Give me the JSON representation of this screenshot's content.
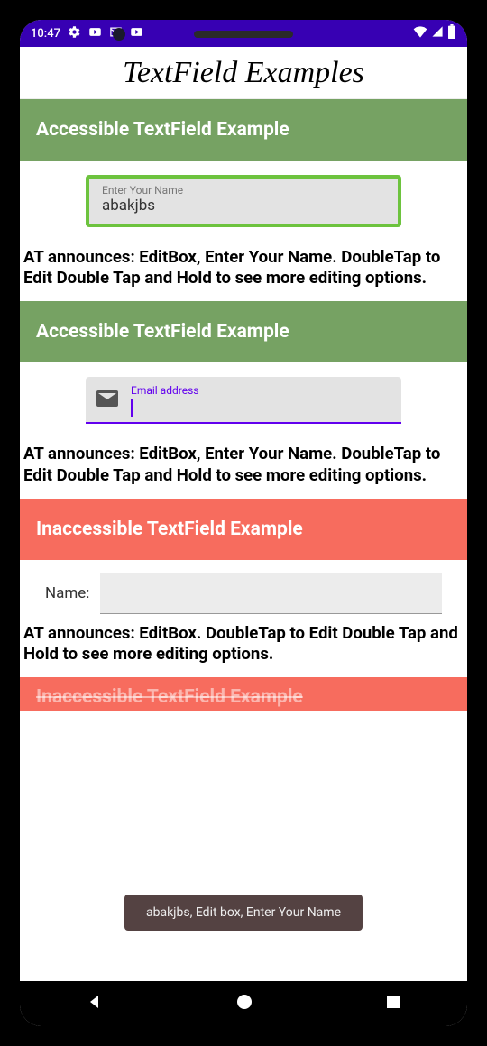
{
  "statusbar": {
    "time": "10:47"
  },
  "app": {
    "title": "TextField Examples"
  },
  "sections": [
    {
      "header": "Accessible TextField Example",
      "field_label": "Enter Your Name",
      "field_value": "abakjbs",
      "caption": "AT announces: EditBox, Enter Your Name. DoubleTap to Edit Double Tap and Hold to see more editing options."
    },
    {
      "header": "Accessible TextField Example",
      "field_label": "Email address",
      "caption": "AT announces: EditBox, Enter Your Name. DoubleTap to Edit Double Tap and Hold to see more editing options."
    },
    {
      "header": "Inaccessible TextField Example",
      "field_label": "Name:",
      "caption": "AT announces: EditBox. DoubleTap to Edit Double Tap and Hold to see more editing options."
    },
    {
      "header": "Inaccessible TextField Example"
    }
  ],
  "toast": {
    "text": "abakjbs, Edit box, Enter Your Name"
  }
}
